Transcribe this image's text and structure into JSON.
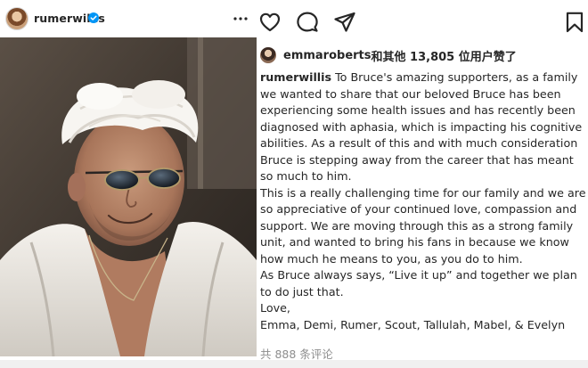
{
  "post": {
    "username": "rumerwillis",
    "verified_icon": "verified-badge-icon",
    "more_icon": "more-options-icon",
    "photo_alt": "photo"
  },
  "actions": {
    "like_icon": "heart-icon",
    "comment_icon": "comment-icon",
    "share_icon": "send-icon",
    "save_icon": "bookmark-icon"
  },
  "likes": {
    "first_user": "emmaroberts",
    "rest_text": "和其他 13,805 位用户赞了"
  },
  "caption": {
    "author": "rumerwillis",
    "para1": "To Bruce's amazing supporters, as a family we wanted to share that our beloved Bruce has been experiencing some health issues and has recently been diagnosed with aphasia, which is impacting his cognitive abilities. As a result of this and with much consideration Bruce is stepping away from the career that has meant so much to him.",
    "para2": "This is a really challenging time for our family and we are so appreciative of your continued love, compassion and support. We are moving through this as a strong family unit, and wanted to bring his fans in because we know how much he means to you, as you do to him.",
    "para3": "As Bruce always says, “Live it up” and together we plan to do just that.",
    "para4": "Love,",
    "para5": "Emma, Demi, Rumer, Scout, Tallulah, Mabel, & Evelyn"
  },
  "comments": {
    "count_text": "共 888 条评论"
  },
  "colors": {
    "text": "#262626",
    "secondary": "#8e8e8e",
    "verified": "#0095f6"
  }
}
